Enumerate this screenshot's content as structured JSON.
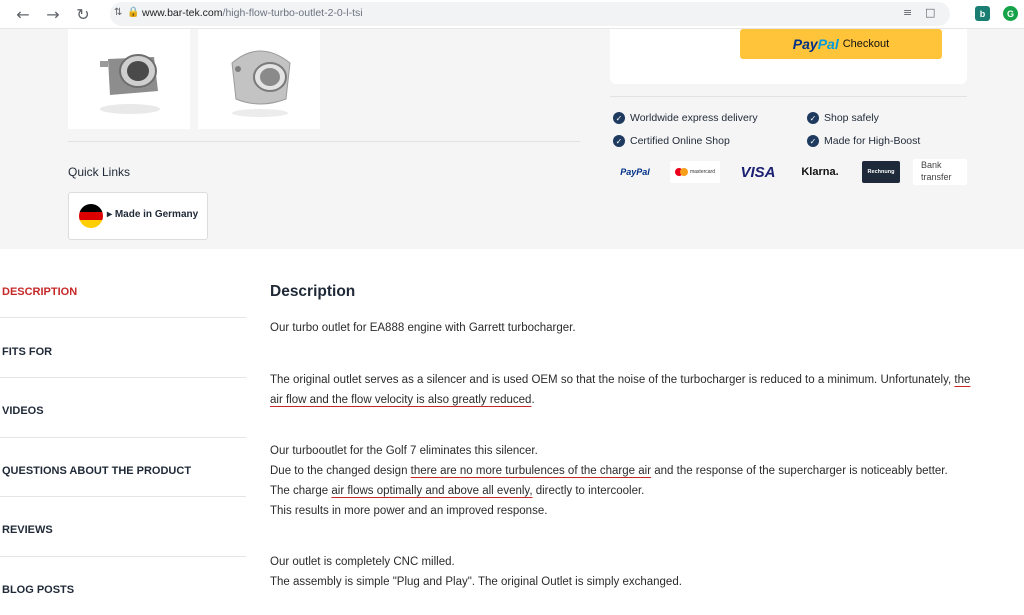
{
  "browser": {
    "url_host": "www.bar-tek.com",
    "url_path": "/high-flow-turbo-outlet-2-0-l-tsi"
  },
  "checkout": {
    "paypal_brand_1": "Pay",
    "paypal_brand_2": "Pal",
    "checkout_label": "Checkout"
  },
  "features": [
    "Worldwide express delivery",
    "Shop safely",
    "Certified Online Shop",
    "Made for High-Boost"
  ],
  "payment_methods": {
    "paypal": "PayPal",
    "mastercard": "mastercard",
    "visa": "VISA",
    "klarna": "Klarna.",
    "rechnung": "Rechnung",
    "bank_transfer_1": "Bank",
    "bank_transfer_2": "transfer"
  },
  "quick_links": {
    "title": "Quick Links",
    "made_in_germany": "Made in Germany"
  },
  "tabs": [
    {
      "label": "DESCRIPTION",
      "active": true
    },
    {
      "label": "FITS FOR",
      "active": false
    },
    {
      "label": "VIDEOS",
      "active": false
    },
    {
      "label": "QUESTIONS ABOUT THE PRODUCT",
      "active": false
    },
    {
      "label": "REVIEWS",
      "active": false
    },
    {
      "label": "BLOG POSTS",
      "active": false
    }
  ],
  "description": {
    "title": "Description",
    "p1": "Our turbo outlet for EA888 engine with Garrett turbocharger.",
    "p2_a": "The original outlet serves as a silencer and is used OEM so that the noise of the turbocharger is reduced to a minimum. Unfortunately, ",
    "p2_u1": "the",
    "p2_u2": "air flow and the flow velocity is also greatly reduced",
    "p2_b": ".",
    "p3_l1": "Our turbooutlet for the Golf 7 eliminates this silencer.",
    "p3_l2_a": "Due to the changed design ",
    "p3_l2_u": "there are no more turbulences of the charge air",
    "p3_l2_b": " and the response of the supercharger is noticeably better.",
    "p3_l3_a": "The charge ",
    "p3_l3_u": "air flows optimally and above all evenly,",
    "p3_l3_b": " directly to intercooler.",
    "p3_l4": "This results in more power and an improved response.",
    "p4_l1": "Our outlet is completely CNC milled.",
    "p4_l2": "The assembly is simple \"Plug and Play\". The original Outlet is simply exchanged."
  },
  "colors": {
    "accent": "#c62828",
    "paypal_yellow": "#ffc439",
    "check_navy": "#1e3a5f"
  }
}
